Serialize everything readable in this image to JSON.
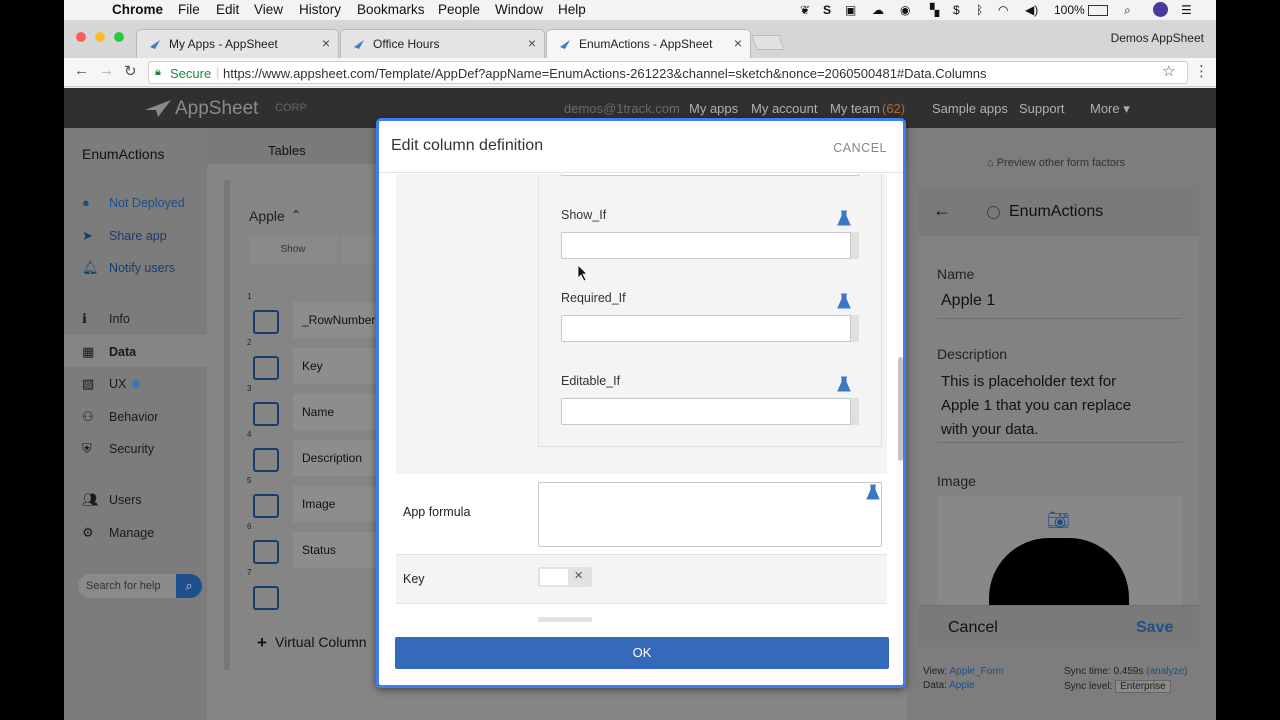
{
  "menubar": {
    "app": "Chrome",
    "items": [
      "File",
      "Edit",
      "View",
      "History",
      "Bookmarks",
      "People",
      "Window",
      "Help"
    ],
    "battery": "100%"
  },
  "tabs": [
    {
      "label": "My Apps - AppSheet",
      "active": false
    },
    {
      "label": "Office Hours",
      "active": false
    },
    {
      "label": "EnumActions - AppSheet",
      "active": true
    }
  ],
  "profile": "Demos AppSheet",
  "address": {
    "secure": "Secure",
    "url": "https://www.appsheet.com/Template/AppDef?appName=EnumActions-261223&channel=sketch&nonce=2060500481#Data.Columns"
  },
  "header": {
    "brand": "AppSheet",
    "brand_tag": "CORP",
    "email": "demos@1track.com",
    "my_apps": "My apps",
    "my_account": "My account",
    "my_team": "My team",
    "team_count": "(62)",
    "sample_apps": "Sample apps",
    "support": "Support",
    "more": "More ▾"
  },
  "leftnav": {
    "app_name": "EnumActions",
    "status_items": [
      {
        "label": "Not Deployed",
        "icon": "exclamation-icon"
      },
      {
        "label": "Share app",
        "icon": "share-icon"
      },
      {
        "label": "Notify users",
        "icon": "bell-icon"
      }
    ],
    "items": [
      {
        "label": "Info",
        "icon": "info-icon"
      },
      {
        "label": "Data",
        "icon": "grid-icon"
      },
      {
        "label": "UX",
        "icon": "image-icon"
      },
      {
        "label": "Behavior",
        "icon": "sitemap-icon"
      },
      {
        "label": "Security",
        "icon": "shield-icon"
      },
      {
        "label": "Users",
        "icon": "users-icon"
      },
      {
        "label": "Manage",
        "icon": "gear-icon"
      }
    ],
    "search_placeholder": "Search for help"
  },
  "main": {
    "tab_tables": "Tables",
    "table_name": "Apple",
    "show_btn": "Show",
    "rows": [
      {
        "num": "1",
        "name": "_RowNumber"
      },
      {
        "num": "2",
        "name": "Key"
      },
      {
        "num": "3",
        "name": "Name"
      },
      {
        "num": "4",
        "name": "Description"
      },
      {
        "num": "5",
        "name": "Image"
      },
      {
        "num": "6",
        "name": "Status"
      },
      {
        "num": "7",
        "name": ""
      }
    ],
    "virtual_column": "Virtual Column"
  },
  "preview": {
    "other_factors": "Preview other form factors",
    "app_title": "EnumActions",
    "name_label": "Name",
    "name_value": "Apple 1",
    "desc_label": "Description",
    "desc_value": "This is placeholder text for Apple 1 that you can replace with your data.",
    "image_label": "Image",
    "cancel": "Cancel",
    "save": "Save",
    "view_label": "View:",
    "view_value": "Apple_Form",
    "data_label": "Data:",
    "data_value": "Apple",
    "sync_time": "Sync time: 0.459s",
    "analyze": "(analyze)",
    "sync_level": "Sync level:",
    "sync_value": "Enterprise"
  },
  "modal": {
    "title": "Edit column definition",
    "cancel": "CANCEL",
    "fields": [
      {
        "label": "Show_If"
      },
      {
        "label": "Required_If"
      },
      {
        "label": "Editable_If"
      }
    ],
    "app_formula": "App formula",
    "key": "Key",
    "ok": "OK"
  }
}
